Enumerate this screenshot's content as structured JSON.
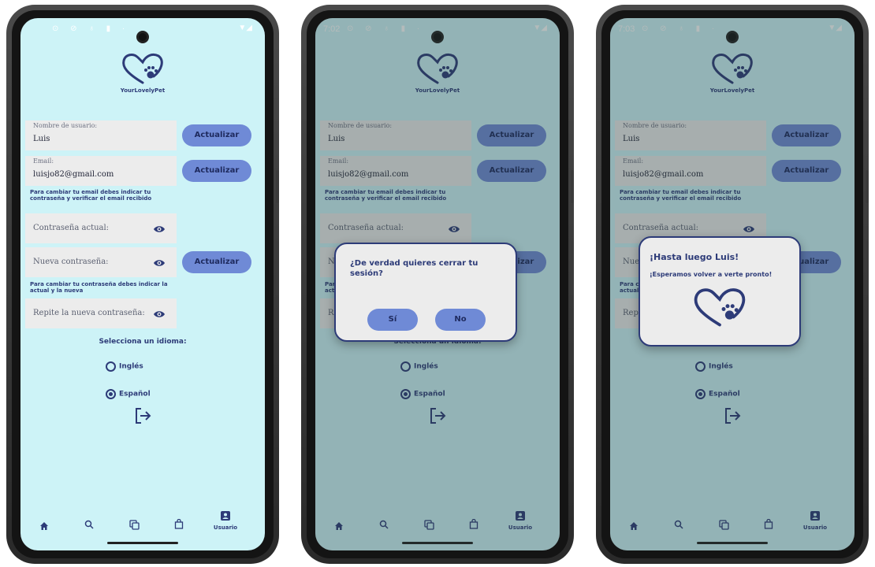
{
  "status_bar": [
    {
      "time": "",
      "icons": "⊙ ⊘ ♁ ▮ ·",
      "right": "▼◢"
    },
    {
      "time": "7:02",
      "icons": "⊙ ⊘ ♁ ▮ ·",
      "right": "▼◢"
    },
    {
      "time": "7:03",
      "icons": "⊙ ⊘ ♁ ▮ ·",
      "right": "▼◢"
    }
  ],
  "app": {
    "brand": "YourLovelyPet"
  },
  "form": {
    "username_label": "Nombre de usuario:",
    "username_value": "Luis",
    "email_label": "Email:",
    "email_value": "luisjo82@gmail.com",
    "update_label": "Actualizar",
    "email_hint": "Para cambiar tu email debes indicar tu contraseña y verificar el email recibido",
    "current_password": "Contraseña actual:",
    "new_password": "Nueva contraseña:",
    "password_hint": "Para cambiar tu contraseña debes indicar la actual y la nueva",
    "repeat_password": "Repite la nueva contraseña:"
  },
  "language": {
    "title": "Selecciona un idioma:",
    "options": [
      {
        "label": "Inglés",
        "selected": false
      },
      {
        "label": "Español",
        "selected": true
      }
    ]
  },
  "nav": {
    "items": [
      {
        "icon": "home-icon"
      },
      {
        "icon": "search-icon"
      },
      {
        "icon": "copy-icon"
      },
      {
        "icon": "shopping-bag-icon"
      },
      {
        "icon": "user-icon",
        "label": "Usuario"
      }
    ]
  },
  "dialog_logout": {
    "question": "¿De verdad quieres cerrar tu sesión?",
    "yes": "Sí",
    "no": "No"
  },
  "dialog_bye": {
    "title": "¡Hasta luego Luis!",
    "message": "¡Esperamos volver a verte pronto!"
  },
  "colors": {
    "background": "#cdf3f7",
    "accent": "#6f8ad6",
    "text_primary": "#2d3b78",
    "field": "#ececec"
  }
}
